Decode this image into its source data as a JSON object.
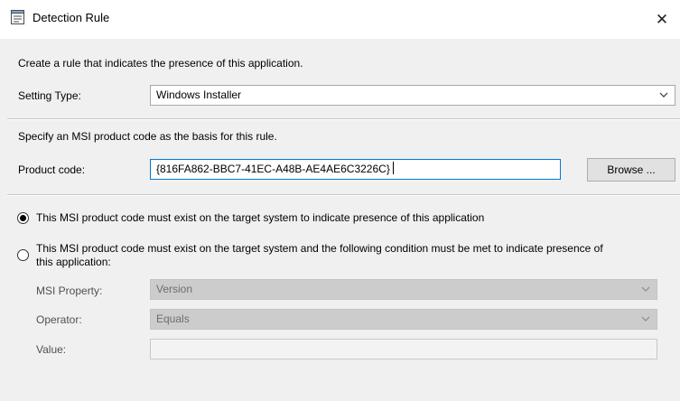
{
  "window": {
    "title": "Detection Rule",
    "close_glyph": "✕"
  },
  "intro_text": "Create a rule that indicates the presence of this application.",
  "setting_type": {
    "label": "Setting Type:",
    "value": "Windows Installer"
  },
  "msi_instruction": "Specify an MSI product code as the basis for this rule.",
  "product_code": {
    "label": "Product code:",
    "value": "{816FA862-BBC7-41EC-A48B-AE4AE6C3226C}",
    "browse_label": "Browse ..."
  },
  "options": [
    {
      "text": "This MSI product code must exist on the target system to indicate presence of this application",
      "checked": true
    },
    {
      "text": "This MSI product code must exist on the target system and the following condition must be met to indicate presence of",
      "text_line2": "this application:",
      "checked": false
    }
  ],
  "condition": {
    "msi_property_label": "MSI Property:",
    "msi_property_value": "Version",
    "operator_label": "Operator:",
    "operator_value": "Equals",
    "value_label": "Value:",
    "value_value": ""
  },
  "colors": {
    "accent_border": "#0078d7",
    "dialog_bg": "#f0f0f0"
  }
}
